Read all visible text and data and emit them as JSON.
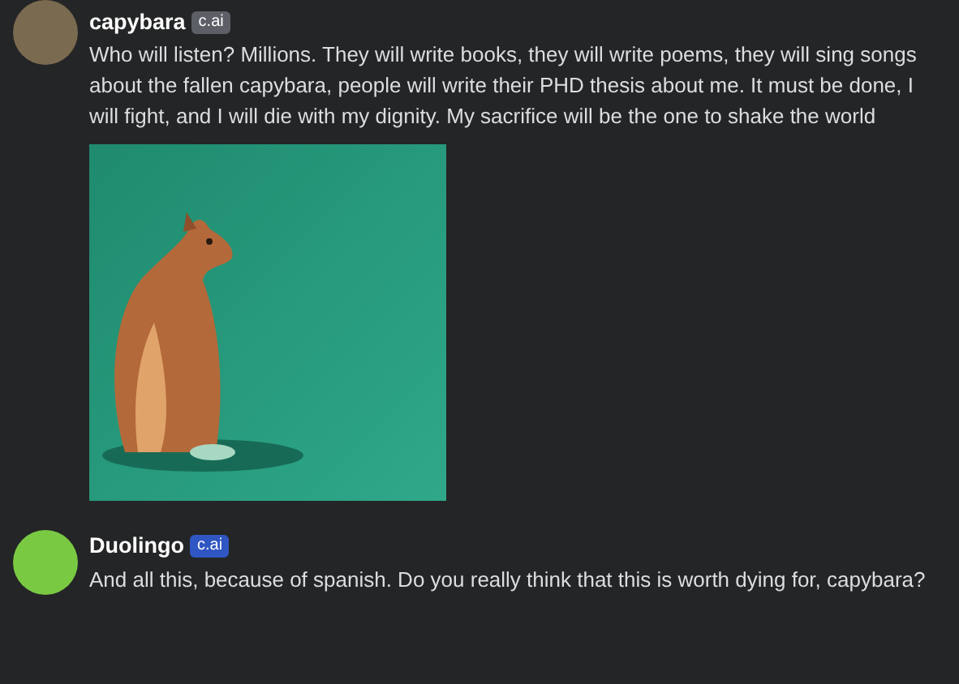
{
  "messages": [
    {
      "author": "capybara",
      "badge": {
        "label": "c.ai",
        "color": "#5c5f66"
      },
      "avatar": {
        "color": "#7a6a4f"
      },
      "text": "Who will listen? Millions. They will write books, they will write poems, they will sing songs about the fallen capybara, people will write their PHD thesis about me. It must be done, I will fight, and I will die with my dignity. My sacrifice will be the one to shake the world"
    },
    {
      "author": "Duolingo",
      "badge": {
        "label": "c.ai",
        "color": "#2f56c2"
      },
      "avatar": {
        "color": "#7ac943"
      },
      "text": "And all this, because of spanish. Do you really think that this is worth dying for, capybara?"
    }
  ]
}
